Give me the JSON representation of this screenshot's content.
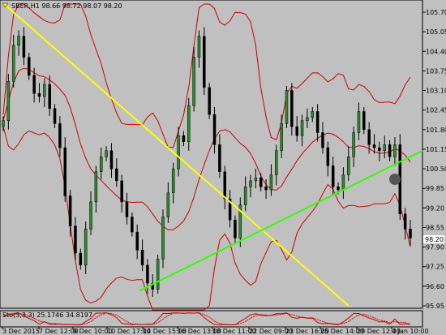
{
  "header": {
    "symbol": "SBER,H1",
    "ohlc": "98.66 98.72 98.07 98.20",
    "title": "SBER,H1  98.66 98.72 98.07 98.20"
  },
  "price_axis": {
    "labels": [
      "105.70",
      "105.05",
      "104.40",
      "103.75",
      "103.10",
      "102.45",
      "101.80",
      "101.15",
      "100.50",
      "99.85",
      "99.20",
      "98.55",
      "97.90",
      "97.25",
      "96.60",
      "95.95"
    ],
    "current_price": "98.20"
  },
  "indicator": {
    "label": "Sto(3,3,3) 25.1746 34.8197"
  },
  "time_axis": {
    "labels": [
      "3 Dec 2015",
      "7 Dec 12:00",
      "9 Dec 10:00",
      "10 Dec 17:00",
      "14 Dec 15:00",
      "16 Dec 13:00",
      "18 Dec 11:00",
      "22 Dec 09:00",
      "23 Dec 16:00",
      "25 Dec 14:00",
      "29 Dec 12:00",
      "4 Jan 10:00"
    ]
  },
  "colors": {
    "background": "#c0c0c0",
    "candle_body": "#2e8b2e",
    "candle_wick": "#000000",
    "bands": "#cc0000",
    "yellow_trendline": "#ffff00",
    "green_trendline": "#33ff00"
  },
  "chart_data": {
    "type": "candlestick",
    "instrument": "SBER,H1",
    "ylim": [
      95.95,
      105.9
    ],
    "timeframe": "H1",
    "trendlines": [
      {
        "color": "yellow",
        "from": {
          "x_label": "3 Dec 2015",
          "price": 105.9
        },
        "to": {
          "x_label": "25 Dec 14:00",
          "price": 95.95
        }
      },
      {
        "color": "green",
        "from": {
          "x_label": "14 Dec 15:00",
          "price": 96.45
        },
        "to": {
          "x_label": "4 Jan 10:00",
          "price": 101.1
        }
      }
    ],
    "closes": [
      102.1,
      103.4,
      104.6,
      104.9,
      104.2,
      103.6,
      103.0,
      102.9,
      103.3,
      102.5,
      102.0,
      101.2,
      99.6,
      98.6,
      97.7,
      97.3,
      98.5,
      99.4,
      100.4,
      100.9,
      101.1,
      100.5,
      100.1,
      99.4,
      98.9,
      98.4,
      97.8,
      97.3,
      96.7,
      96.5,
      97.5,
      98.9,
      99.7,
      100.5,
      101.6,
      101.4,
      102.6,
      104.2,
      104.9,
      103.2,
      102.3,
      101.3,
      100.4,
      99.5,
      98.8,
      98.2,
      99.3,
      99.9,
      100.1,
      100.2,
      99.9,
      99.8,
      100.3,
      101.1,
      102.0,
      103.1,
      101.9,
      101.6,
      102.1,
      102.2,
      102.4,
      101.7,
      101.2,
      100.6,
      99.9,
      99.8,
      100.3,
      100.9,
      101.7,
      102.4,
      101.8,
      101.3,
      101.2,
      101.1,
      101.3,
      100.9,
      101.3,
      99.0,
      98.5,
      98.2
    ]
  }
}
